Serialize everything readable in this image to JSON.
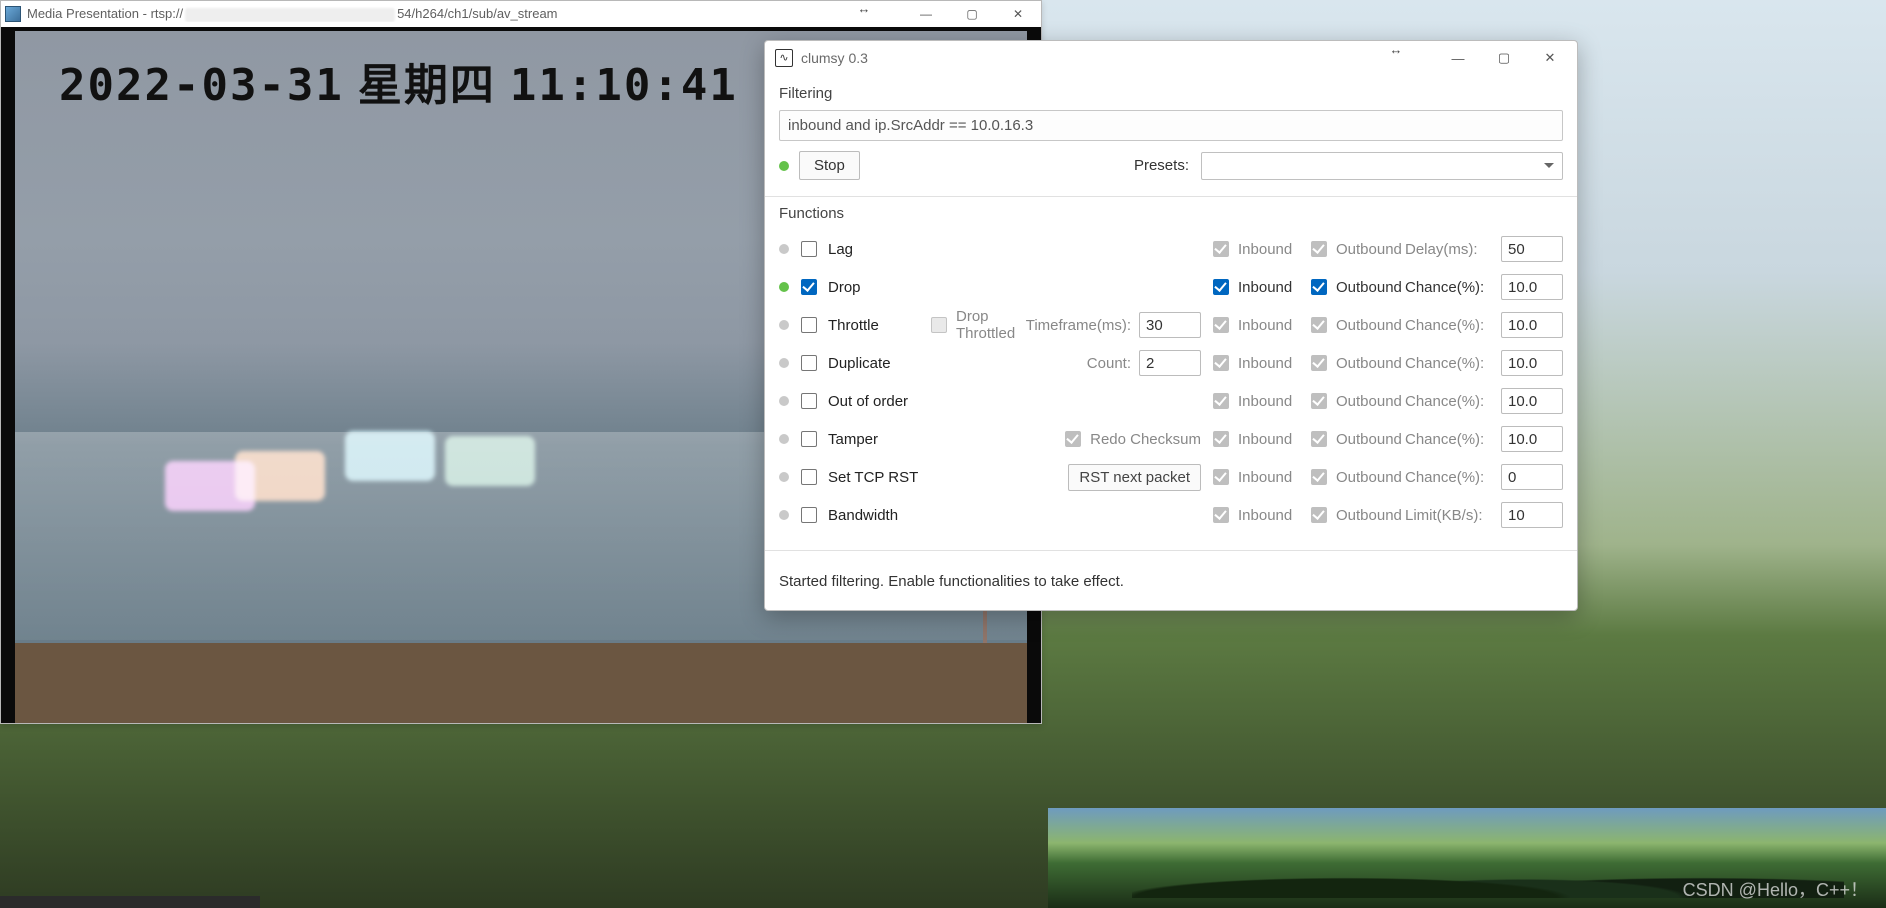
{
  "media_player": {
    "title_prefix": "Media Presentation - rtsp://",
    "title_suffix": "54/h264/ch1/sub/av_stream",
    "osd_date": "2022-03-31",
    "osd_weekday": "星期四",
    "osd_time": "11:10:41"
  },
  "resize_glyph": "↔",
  "window_controls": {
    "min": "—",
    "max": "▢",
    "close": "✕"
  },
  "clumsy": {
    "title": "clumsy 0.3",
    "icon_glyph": "∿",
    "filtering_label": "Filtering",
    "filter_expr": "inbound and ip.SrcAddr == 10.0.16.3",
    "start_button": "Stop",
    "presets_label": "Presets:",
    "functions_label": "Functions",
    "inbound_label": "Inbound",
    "outbound_label": "Outbound",
    "rows": {
      "lag": {
        "label": "Lag",
        "checked": false,
        "active": false,
        "inb": true,
        "outb": true,
        "in_en": false,
        "out_en": false,
        "param_label": "Delay(ms):",
        "param_val": "50"
      },
      "drop": {
        "label": "Drop",
        "checked": true,
        "active": true,
        "inb": true,
        "outb": true,
        "in_en": true,
        "out_en": true,
        "param_label": "Chance(%):",
        "param_val": "10.0"
      },
      "throttle": {
        "label": "Throttle",
        "checked": false,
        "active": false,
        "extra_cb_label": "Drop Throttled",
        "extra_cb": false,
        "tf_label": "Timeframe(ms):",
        "tf_val": "30",
        "inb": true,
        "outb": true,
        "in_en": false,
        "out_en": false,
        "param_label": "Chance(%):",
        "param_val": "10.0"
      },
      "duplicate": {
        "label": "Duplicate",
        "checked": false,
        "active": false,
        "count_label": "Count:",
        "count_val": "2",
        "inb": true,
        "outb": true,
        "in_en": false,
        "out_en": false,
        "param_label": "Chance(%):",
        "param_val": "10.0"
      },
      "ooo": {
        "label": "Out of order",
        "checked": false,
        "active": false,
        "inb": true,
        "outb": true,
        "in_en": false,
        "out_en": false,
        "param_label": "Chance(%):",
        "param_val": "10.0"
      },
      "tamper": {
        "label": "Tamper",
        "checked": false,
        "active": false,
        "redo_label": "Redo Checksum",
        "redo": true,
        "inb": true,
        "outb": true,
        "in_en": false,
        "out_en": false,
        "param_label": "Chance(%):",
        "param_val": "10.0"
      },
      "rst": {
        "label": "Set TCP RST",
        "checked": false,
        "active": false,
        "rst_btn": "RST next packet",
        "inb": true,
        "outb": true,
        "in_en": false,
        "out_en": false,
        "param_label": "Chance(%):",
        "param_val": "0"
      },
      "bw": {
        "label": "Bandwidth",
        "checked": false,
        "active": false,
        "inb": true,
        "outb": true,
        "in_en": false,
        "out_en": false,
        "param_label": "Limit(KB/s):",
        "param_val": "10"
      }
    },
    "status_msg": "Started filtering. Enable functionalities to take effect."
  },
  "watermark": "CSDN @Hello，C++！"
}
